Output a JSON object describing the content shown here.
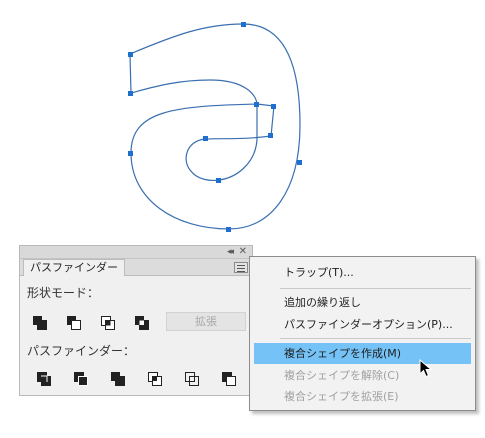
{
  "panel": {
    "tab_label": "パスファインダー",
    "shape_modes_label": "形状モード：",
    "expand_label": "拡張",
    "pathfinders_label": "パスファインダー："
  },
  "flyout": {
    "items": [
      {
        "label": "トラップ(T)...",
        "state": "normal"
      },
      {
        "label": "追加の繰り返し",
        "state": "normal"
      },
      {
        "label": "パスファインダーオプション(P)...",
        "state": "normal"
      },
      {
        "label": "複合シェイプを作成(M)",
        "state": "highlighted"
      },
      {
        "label": "複合シェイプを解除(C)",
        "state": "disabled"
      },
      {
        "label": "複合シェイプを拡張(E)",
        "state": "disabled"
      }
    ]
  },
  "colors": {
    "path_stroke": "#3a6fb0",
    "anchor_fill": "#1f6fd1",
    "highlight": "#75c2f6"
  }
}
